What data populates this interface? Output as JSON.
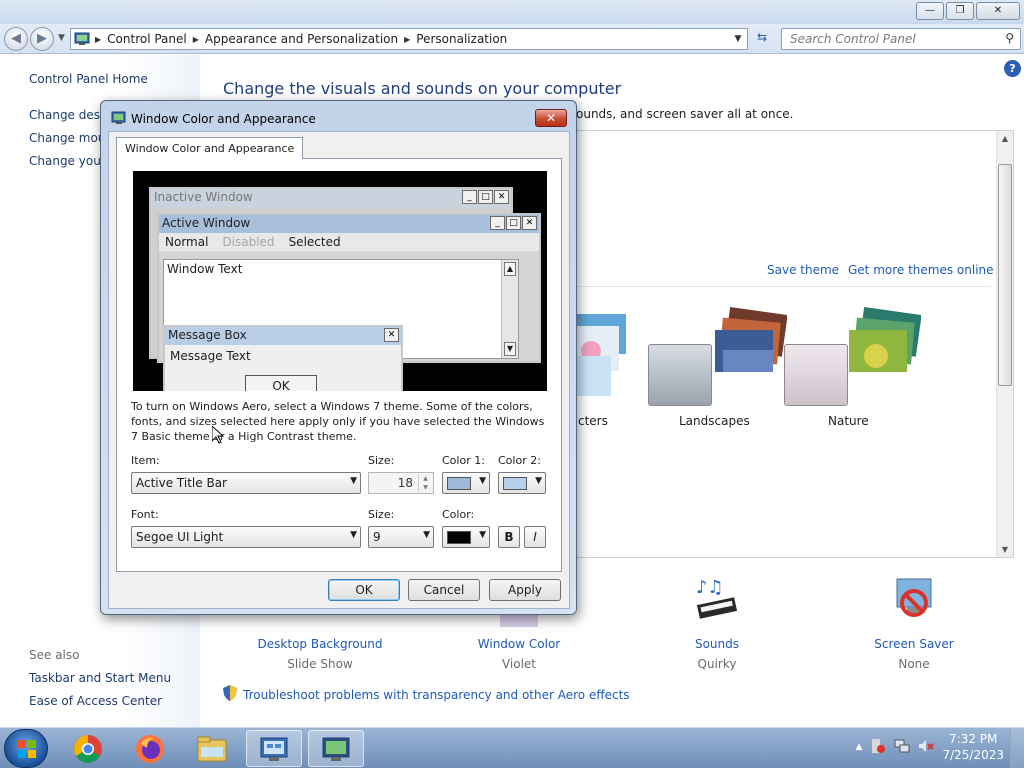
{
  "address": {
    "crumbs": [
      "Control Panel",
      "Appearance and Personalization",
      "Personalization"
    ],
    "search_placeholder": "Search Control Panel"
  },
  "left_pane": {
    "home": "Control Panel Home",
    "tasks": [
      "Change deskt",
      "Change mous",
      "Change your"
    ],
    "see_also_heading": "See also",
    "see_also": [
      "Taskbar and Start Menu",
      "Ease of Access Center"
    ]
  },
  "main": {
    "title": "Change the visuals and sounds on your computer",
    "subtitle": "ounds, and screen saver all at once.",
    "save_theme": "Save theme",
    "get_more_themes": "Get more themes online",
    "themes": [
      "cters",
      "Landscapes",
      "Nature"
    ],
    "bottom_items": [
      {
        "title": "Desktop Background",
        "sub": "Slide Show"
      },
      {
        "title": "Window Color",
        "sub": "Violet"
      },
      {
        "title": "Sounds",
        "sub": "Quirky"
      },
      {
        "title": "Screen Saver",
        "sub": "None"
      }
    ],
    "troubleshoot": "Troubleshoot problems with transparency and other Aero effects"
  },
  "dialog": {
    "title": "Window Color and Appearance",
    "tab": "Window Color and Appearance",
    "preview": {
      "inactive_window": "Inactive Window",
      "active_window": "Active Window",
      "menu_normal": "Normal",
      "menu_disabled": "Disabled",
      "menu_selected": "Selected",
      "window_text": "Window Text",
      "message_box": "Message Box",
      "message_text": "Message Text",
      "ok": "OK"
    },
    "info": "To turn on Windows Aero, select a Windows 7 theme.  Some of the colors, fonts, and sizes selected here apply only if you have selected the Windows 7 Basic theme or a High Contrast theme.",
    "item_label": "Item:",
    "item_value": "Active Title Bar",
    "size_label": "Size:",
    "item_size": "18",
    "color1_label": "Color 1:",
    "color2_label": "Color 2:",
    "font_label": "Font:",
    "font_value": "Segoe UI Light",
    "font_size_label": "Size:",
    "font_size": "9",
    "color_label": "Color:",
    "bold": "B",
    "italic": "I",
    "ok": "OK",
    "cancel": "Cancel",
    "apply": "Apply",
    "colors": {
      "color1": "#9eb8d8",
      "color2": "#b8d0ec",
      "font_color": "#000000"
    }
  },
  "taskbar": {
    "time": "7:32 PM",
    "date": "7/25/2023"
  }
}
